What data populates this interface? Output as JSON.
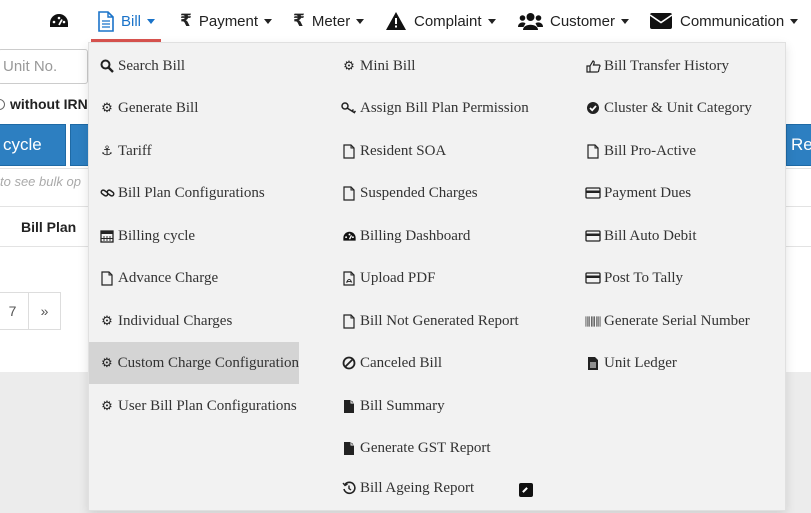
{
  "navbar": {
    "items": [
      {
        "label": "",
        "icon": "dashboard-icon"
      },
      {
        "label": "Bill",
        "icon": "file-icon",
        "active": true
      },
      {
        "label": "Payment",
        "icon": "rupee-icon"
      },
      {
        "label": "Meter",
        "icon": "rupee-icon"
      },
      {
        "label": "Complaint",
        "icon": "warning-icon"
      },
      {
        "label": "Customer",
        "icon": "users-icon"
      },
      {
        "label": "Communication",
        "icon": "envelope-icon"
      }
    ],
    "active_color": "#1a73c9",
    "active_underline_color": "#d9534f"
  },
  "page": {
    "unit_placeholder": "Unit No.",
    "radio_label": "without IRN",
    "button_left_label": "cycle",
    "button_right_label": "Rep",
    "bulk_hint": "to see bulk op",
    "table_header": "Bill Plan",
    "pagination": [
      "7",
      "»"
    ],
    "button_color": "#2d7fc1"
  },
  "dropdown": {
    "columns": [
      {
        "items": [
          {
            "label": "Search Bill",
            "icon": "search-icon"
          },
          {
            "label": "Generate Bill",
            "icon": "gear-icon"
          },
          {
            "label": "Tariff",
            "icon": "anchor-icon"
          },
          {
            "label": "Bill Plan Configurations",
            "icon": "link-icon"
          },
          {
            "label": "Billing cycle",
            "icon": "calendar-icon"
          },
          {
            "label": "Advance Charge",
            "icon": "file-icon"
          },
          {
            "label": "Individual Charges",
            "icon": "gear-icon"
          },
          {
            "label": "Custom Charge Configuration",
            "icon": "gear-icon",
            "highlight": true
          },
          {
            "label": "User Bill Plan Configurations",
            "icon": "gear-icon"
          }
        ]
      },
      {
        "items": [
          {
            "label": "Mini Bill",
            "icon": "gear-icon"
          },
          {
            "label": "Assign Bill Plan Permission",
            "icon": "key-icon"
          },
          {
            "label": "Resident SOA",
            "icon": "file-icon"
          },
          {
            "label": "Suspended Charges",
            "icon": "file-icon"
          },
          {
            "label": "Billing Dashboard",
            "icon": "dashboard-icon"
          },
          {
            "label": "Upload PDF",
            "icon": "file-pdf-icon"
          },
          {
            "label": "Bill Not Generated Report",
            "icon": "file-icon"
          },
          {
            "label": "Canceled Bill",
            "icon": "ban-icon"
          },
          {
            "label": "Bill Summary",
            "icon": "file-solid-icon"
          },
          {
            "label": "Generate GST Report",
            "icon": "file-solid-icon"
          },
          {
            "label": "Bill Ageing Report",
            "icon": "history-icon"
          }
        ]
      },
      {
        "items": [
          {
            "label": "Bill Transfer History",
            "icon": "hand-pointer-icon"
          },
          {
            "label": "Cluster & Unit Category",
            "icon": "check-circle-icon"
          },
          {
            "label": "Bill Pro-Active",
            "icon": "file-icon"
          },
          {
            "label": "Payment Dues",
            "icon": "credit-card-icon"
          },
          {
            "label": "Bill Auto Debit",
            "icon": "credit-card-icon"
          },
          {
            "label": "Post To Tally",
            "icon": "credit-card-icon"
          },
          {
            "label": "Generate Serial Number",
            "icon": "barcode-icon"
          },
          {
            "label": "Unit Ledger",
            "icon": "file-text-icon"
          }
        ]
      }
    ],
    "highlight_color": "#d4d4d4",
    "background_color": "#f2f2f2"
  }
}
